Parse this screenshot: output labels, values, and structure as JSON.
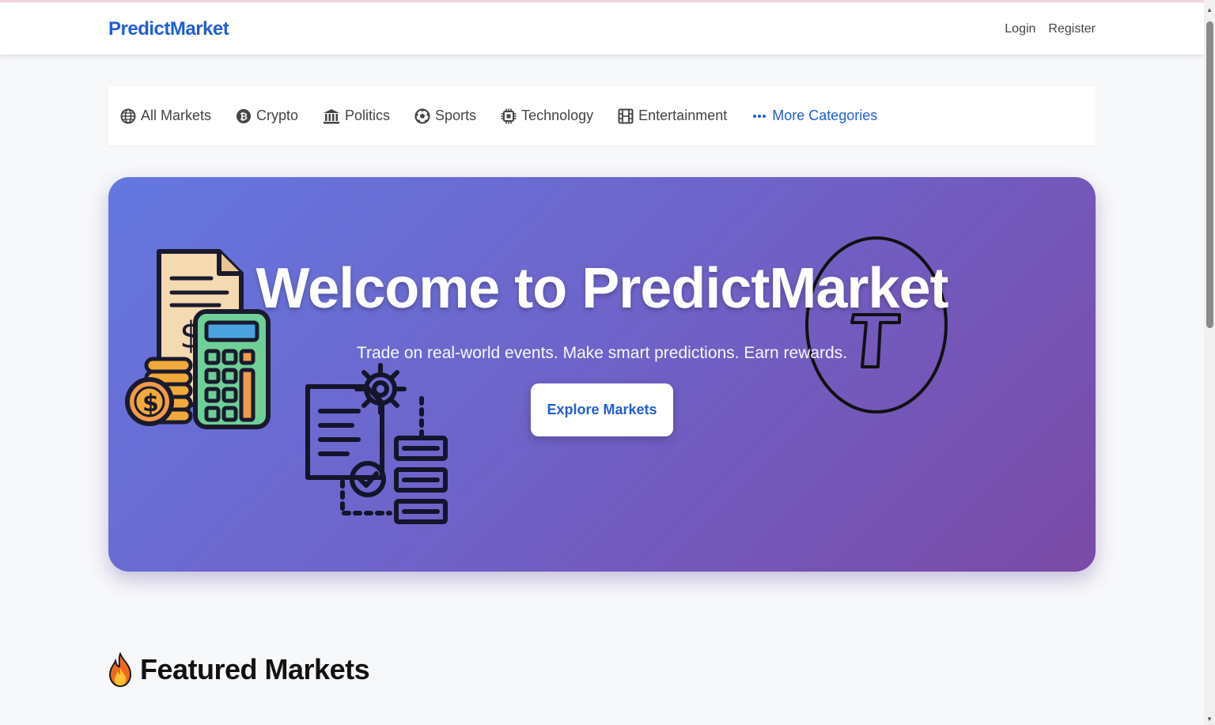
{
  "navbar": {
    "brand": "PredictMarket",
    "links": [
      {
        "label": "Login"
      },
      {
        "label": "Register"
      }
    ]
  },
  "categories": [
    {
      "label": "All Markets",
      "icon": "globe-icon"
    },
    {
      "label": "Crypto",
      "icon": "bitcoin-icon"
    },
    {
      "label": "Politics",
      "icon": "landmark-icon"
    },
    {
      "label": "Sports",
      "icon": "soccer-ball-icon"
    },
    {
      "label": "Technology",
      "icon": "microchip-icon"
    },
    {
      "label": "Entertainment",
      "icon": "film-icon"
    },
    {
      "label": "More Categories",
      "icon": "ellipsis-icon"
    }
  ],
  "hero": {
    "title": "Welcome to PredictMarket",
    "subtitle": "Trade on real-world events. Make smart predictions. Earn rewards.",
    "cta_label": "Explore Markets"
  },
  "featured": {
    "heading": "Featured Markets",
    "icon": "fire-icon"
  },
  "colors": {
    "brand": "#1f5fd6",
    "hero_gradient_start": "#6478e0",
    "hero_gradient_end": "#7a4aa6",
    "page_bg": "#f7f8fa"
  }
}
